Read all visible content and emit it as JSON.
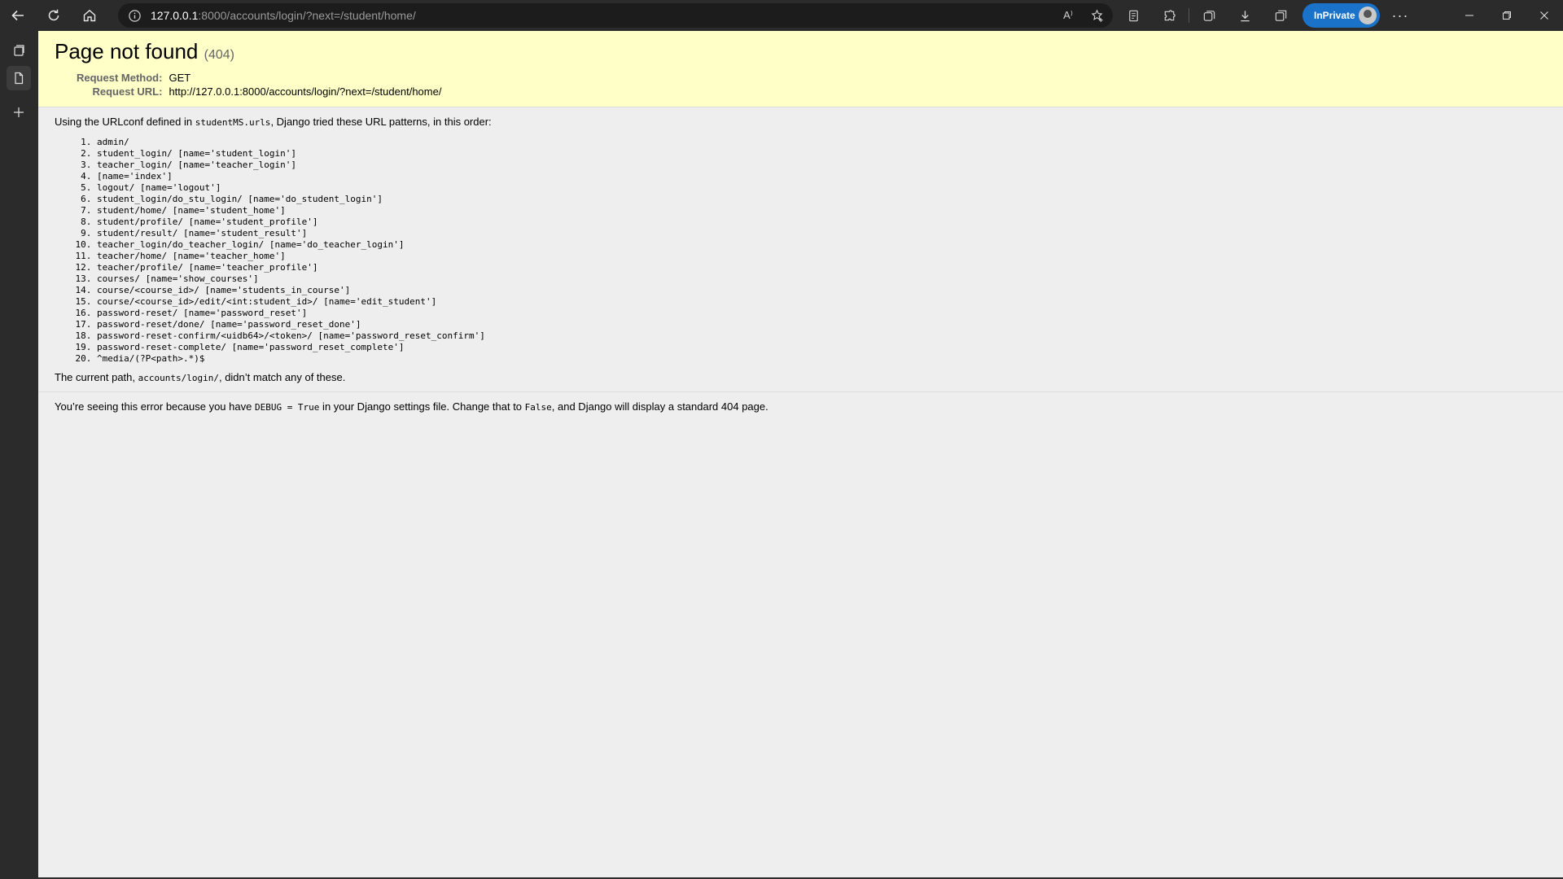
{
  "browser": {
    "url_host": "127.0.0.1",
    "url_rest": ":8000/accounts/login/?next=/student/home/",
    "inprivate_label": "InPrivate",
    "read_aloud_glyph": "A⁾",
    "more_glyph": "···"
  },
  "page": {
    "title": "Page not found",
    "status": "(404)",
    "request_method_label": "Request Method:",
    "request_method": "GET",
    "request_url_label": "Request URL:",
    "request_url": "http://127.0.0.1:8000/accounts/login/?next=/student/home/",
    "urlconf_pre": "Using the URLconf defined in ",
    "urlconf_module": "studentMS.urls",
    "urlconf_post": ", Django tried these URL patterns, in this order:",
    "patterns": [
      "admin/",
      "student_login/ [name='student_login']",
      "teacher_login/ [name='teacher_login']",
      "[name='index']",
      "logout/ [name='logout']",
      "student_login/do_stu_login/ [name='do_student_login']",
      "student/home/ [name='student_home']",
      "student/profile/ [name='student_profile']",
      "student/result/ [name='student_result']",
      "teacher_login/do_teacher_login/ [name='do_teacher_login']",
      "teacher/home/ [name='teacher_home']",
      "teacher/profile/ [name='teacher_profile']",
      "courses/ [name='show_courses']",
      "course/<course_id>/ [name='students_in_course']",
      "course/<course_id>/edit/<int:student_id>/ [name='edit_student']",
      "password-reset/ [name='password_reset']",
      "password-reset/done/ [name='password_reset_done']",
      "password-reset-confirm/<uidb64>/<token>/ [name='password_reset_confirm']",
      "password-reset-complete/ [name='password_reset_complete']",
      "^media/(?P<path>.*)$"
    ],
    "current_path_pre": "The current path, ",
    "current_path": "accounts/login/",
    "current_path_post": ", didn’t match any of these.",
    "debug_pre": "You’re seeing this error because you have ",
    "debug_code": "DEBUG = True",
    "debug_mid": " in your Django settings file. Change that to ",
    "debug_false": "False",
    "debug_post": ", and Django will display a standard 404 page."
  }
}
